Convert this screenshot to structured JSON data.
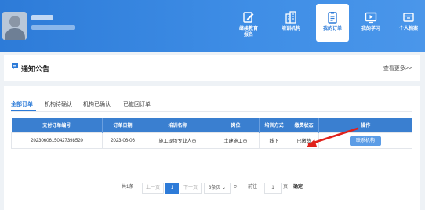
{
  "nav": [
    {
      "label_lines": [
        "继续教育",
        "报名"
      ]
    },
    {
      "label_lines": [
        "培训机构"
      ]
    },
    {
      "label_lines": [
        "我的订单"
      ]
    },
    {
      "label_lines": [
        "我的学习"
      ]
    },
    {
      "label_lines": [
        "个人档案"
      ]
    }
  ],
  "notice": {
    "title": "通知公告",
    "more": "查看更多>>"
  },
  "tabs": [
    "全部订单",
    "机构待确认",
    "机构已确认",
    "已撤回订单"
  ],
  "table": {
    "headers": [
      "支付订单编号",
      "订单日期",
      "培训名称",
      "岗位",
      "培训方式",
      "缴费状态",
      "操作"
    ],
    "rows": [
      {
        "order_no": "20230606150427398520",
        "date": "2023-06-06",
        "name": "施工现场专业人员",
        "post": "土建施工员",
        "mode": "线下",
        "status": "已缴费",
        "action": "联系机构"
      }
    ]
  },
  "pager": {
    "total": "共1条",
    "prev": "上一页",
    "page": "1",
    "next": "下一页",
    "per_page": "3条页",
    "goto": "前往",
    "goto_value": "1",
    "page_unit": "页",
    "confirm": "确定"
  },
  "colors": {
    "primary": "#2d7bd8",
    "header_row": "#3a7fd0",
    "button": "#5b9ce6",
    "arrow": "#e0201a"
  }
}
